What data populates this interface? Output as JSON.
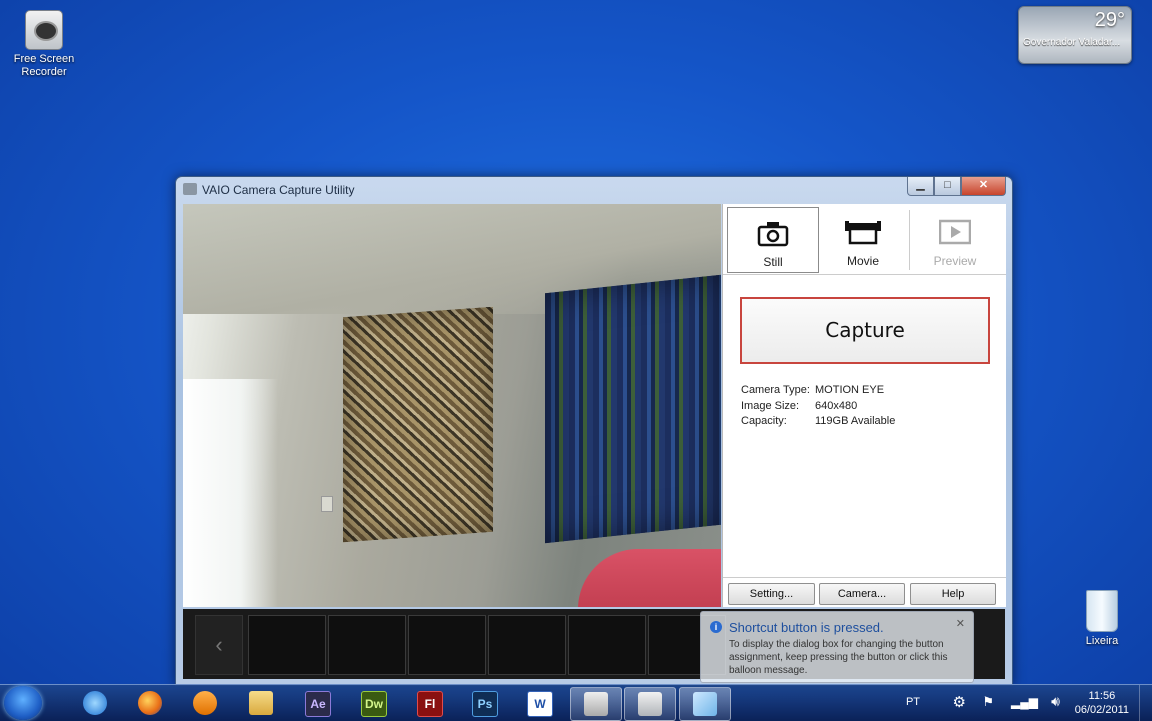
{
  "desktop": {
    "icons": [
      {
        "label": "Free Screen Recorder"
      },
      {
        "label": "Lixeira"
      }
    ],
    "weather": {
      "temp": "29°",
      "location": "Governador Valadar..."
    }
  },
  "window": {
    "title": "VAIO Camera Capture Utility",
    "modes": [
      {
        "label": "Still",
        "icon": "camera-icon",
        "selected": true
      },
      {
        "label": "Movie",
        "icon": "movie-camera-icon",
        "selected": false
      },
      {
        "label": "Preview",
        "icon": "play-icon",
        "disabled": true
      }
    ],
    "capture_label": "Capture",
    "info": {
      "camera_type_label": "Camera Type:",
      "camera_type_value": "MOTION EYE",
      "image_size_label": "Image Size:",
      "image_size_value": "640x480",
      "capacity_label": "Capacity:",
      "capacity_value": "119GB Available"
    },
    "buttons": {
      "setting": "Setting...",
      "camera": "Camera...",
      "help": "Help"
    }
  },
  "balloon": {
    "title": "Shortcut button is pressed.",
    "text": "To display the dialog box for changing the button assignment, keep pressing the button or click this balloon message."
  },
  "taskbar": {
    "apps": [
      "Internet Explorer",
      "Firefox",
      "Media Player",
      "Windows Explorer",
      "After Effects",
      "Dreamweaver",
      "Flash",
      "Photoshop",
      "Word",
      "VAIO Camera Capture Utility",
      "Free Screen Recorder",
      "Notepad"
    ],
    "app_badges": {
      "ae": "Ae",
      "dw": "Dw",
      "fl": "Fl",
      "ps": "Ps",
      "word": "W"
    },
    "language": "PT",
    "time": "11:56",
    "date": "06/02/2011"
  }
}
